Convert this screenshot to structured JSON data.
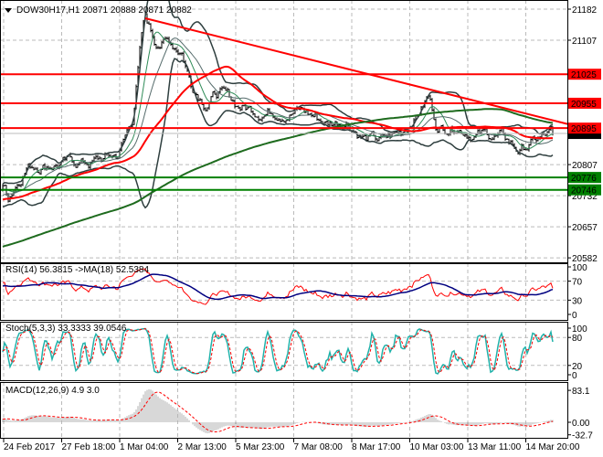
{
  "header": {
    "symbol_info": "DOW30H17,H1  20871 20888 20871 20882"
  },
  "chart_data": {
    "type": "candlestick",
    "title": "DOW30H17,H1",
    "last_bar": {
      "open": 20871,
      "high": 20888,
      "low": 20871,
      "close": 20882
    },
    "ylim": [
      20582,
      21182
    ],
    "price_ticks": [
      21182,
      21107,
      20807,
      20732,
      20657,
      20582
    ],
    "time_labels": [
      "24 Feb 2017",
      "27 Feb 18:00",
      "1 Mar 04:00",
      "2 Mar 13:00",
      "5 Mar 23:00",
      "7 Mar 08:00",
      "8 Mar 17:00",
      "10 Mar 03:00",
      "13 Mar 11:00",
      "14 Mar 20:00"
    ],
    "price_path_bar_index_vs_price": [
      [
        1,
        20752
      ],
      [
        3,
        20730
      ],
      [
        13,
        20807
      ],
      [
        28,
        20812
      ],
      [
        48,
        20812
      ],
      [
        63,
        20829
      ],
      [
        71,
        20917
      ],
      [
        76,
        21116
      ],
      [
        78,
        21160
      ],
      [
        83,
        21105
      ],
      [
        91,
        21105
      ],
      [
        98,
        21083
      ],
      [
        103,
        21006
      ],
      [
        111,
        20962
      ],
      [
        118,
        20984
      ],
      [
        128,
        20950
      ],
      [
        138,
        20939
      ],
      [
        148,
        20939
      ],
      [
        163,
        20939
      ],
      [
        178,
        20906
      ],
      [
        188,
        20917
      ],
      [
        198,
        20873
      ],
      [
        208,
        20862
      ],
      [
        218,
        20884
      ],
      [
        228,
        20939
      ],
      [
        233,
        20972
      ],
      [
        238,
        20895
      ],
      [
        248,
        20906
      ],
      [
        258,
        20884
      ],
      [
        273,
        20873
      ],
      [
        283,
        20840
      ],
      [
        291,
        20862
      ],
      [
        301,
        20882
      ]
    ],
    "resistance_levels": [
      {
        "label": "21025",
        "value": 21025
      },
      {
        "label": "20955",
        "value": 20955
      },
      {
        "label": "20895",
        "value": 20895
      }
    ],
    "support_levels": [
      {
        "label": "20776",
        "value": 20776
      },
      {
        "label": "20746",
        "value": 20746
      }
    ],
    "current_price": {
      "label": "20882",
      "value": 20882
    },
    "trendline": {
      "from": [
        78,
        21160
      ],
      "to": [
        309,
        20905
      ]
    },
    "colors": {
      "resistance": "#ff0000",
      "support": "#008000",
      "trendline": "#ff0000",
      "ma_fast": "#ff0000",
      "ma_slow": "#1e6b1e",
      "bands": "#2f3f3f"
    },
    "indicators": {
      "rsi": {
        "label": "RSI(14) 56.3815  ->MA(18) 52.5384",
        "ticks": [
          "100",
          "70",
          "30",
          "0"
        ],
        "ylim": [
          0,
          100
        ]
      },
      "stoch": {
        "label": "Stoch(5,3,3) 33.3333 39.0546",
        "ticks": [
          "100",
          "80",
          "20",
          "0"
        ],
        "ylim": [
          0,
          100
        ]
      },
      "macd": {
        "label": "MACD(12,26,9) 4.9 3.0",
        "ticks": [
          "83.1",
          "0.00",
          "-32.7"
        ],
        "ylim": [
          -32.7,
          83.1
        ]
      }
    }
  }
}
